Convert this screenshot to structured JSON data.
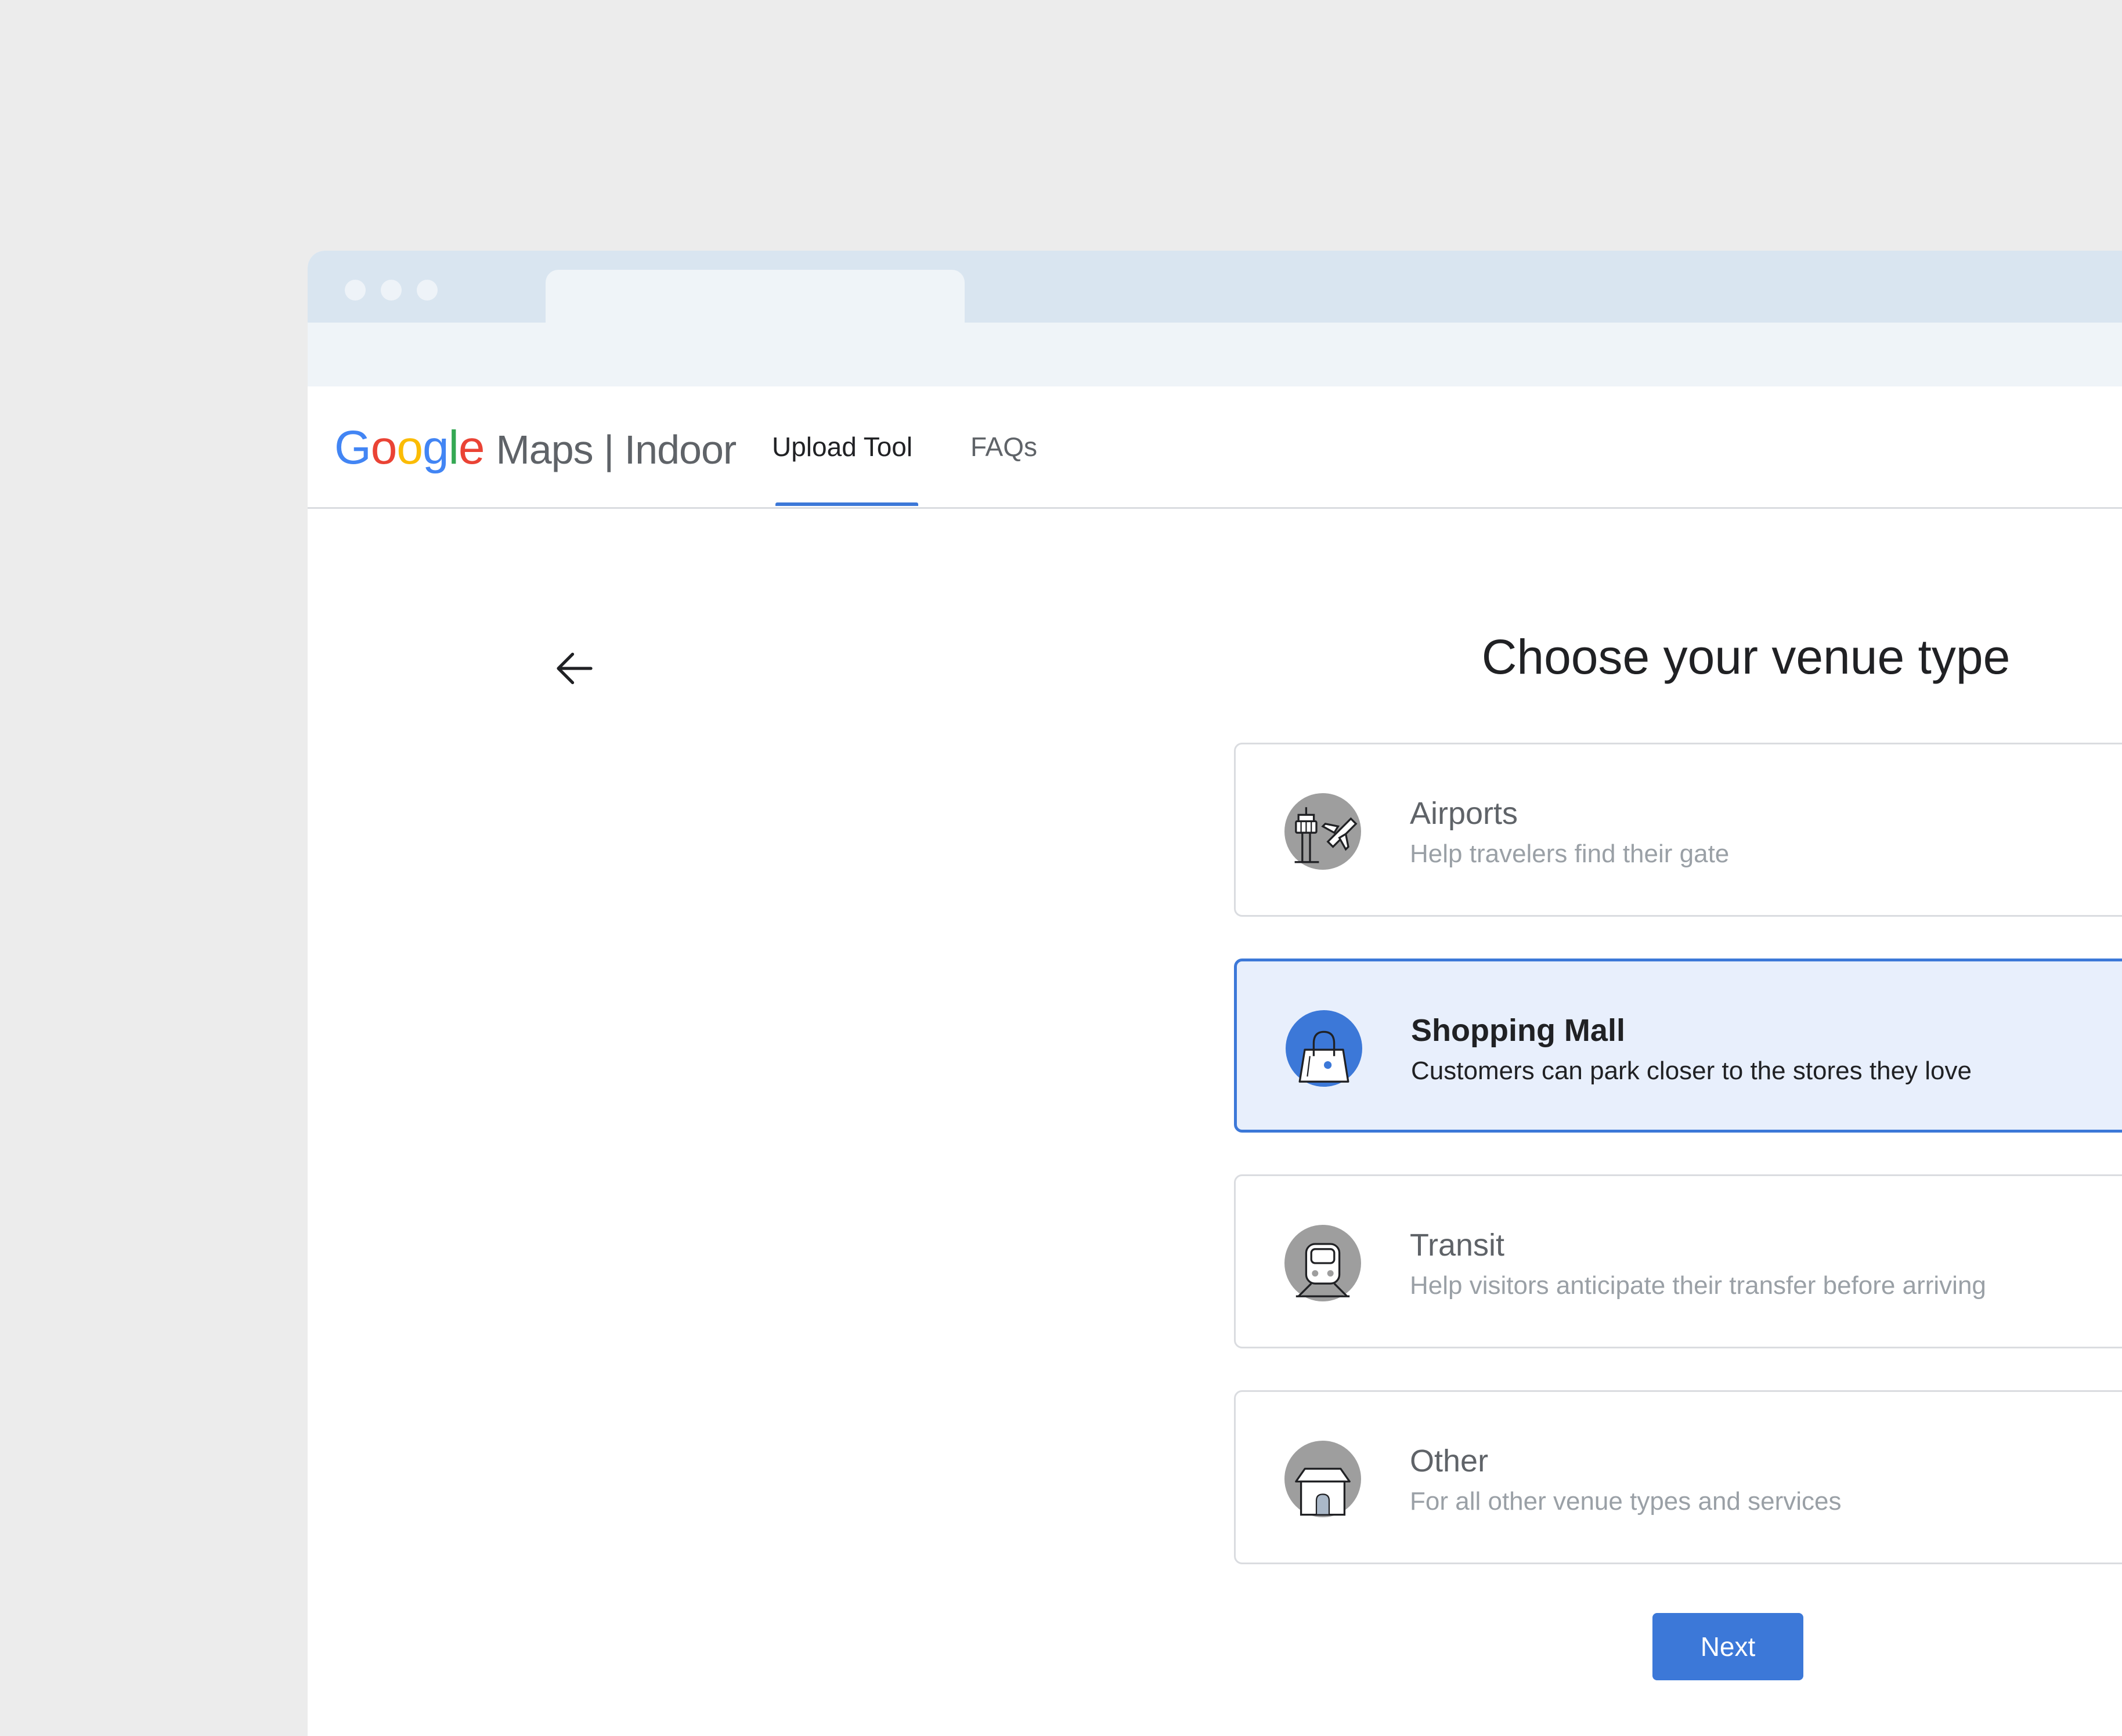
{
  "logo": {
    "letters": [
      "G",
      "o",
      "o",
      "g",
      "l",
      "e"
    ],
    "product": "Maps | Indoor"
  },
  "nav": {
    "tabs": [
      {
        "label": "Upload Tool",
        "selected": true
      },
      {
        "label": "FAQs",
        "selected": false
      }
    ]
  },
  "main": {
    "title": "Choose your venue type",
    "venues": [
      {
        "title": "Airports",
        "description": "Help travelers find their gate",
        "icon": "airport-icon",
        "selected": false
      },
      {
        "title": "Shopping Mall",
        "description": "Customers can park closer to the stores they love",
        "icon": "shopping-bag-icon",
        "selected": true
      },
      {
        "title": "Transit",
        "description": "Help visitors anticipate their transfer before arriving",
        "icon": "train-icon",
        "selected": false
      },
      {
        "title": "Other",
        "description": "For all other venue types and services",
        "icon": "building-icon",
        "selected": false
      }
    ],
    "next_label": "Next"
  },
  "colors": {
    "accent": "#3c78d8",
    "selected_background": "#e8effc",
    "window_background": "#ececec",
    "titlebar": "#d9e5f0"
  }
}
